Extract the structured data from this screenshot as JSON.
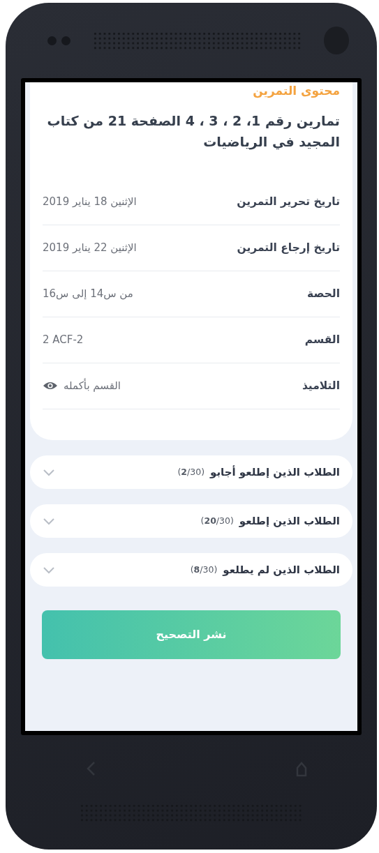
{
  "exercise": {
    "section_title": "محتوى التمرين",
    "title": "تمارين رقم 1، 2 ، 3 ، 4 الصفحة 21 من كتاب المجيد في الرياضيات"
  },
  "details": [
    {
      "label": "تاريخ تحرير التمرين",
      "value": "الإثنين 18 يناير 2019",
      "kind": "text"
    },
    {
      "label": "تاريخ إرجاع التمرين",
      "value": "الإثنين 22 يناير 2019",
      "kind": "text"
    },
    {
      "label": "الحصة",
      "value": "من س14 إلى س16",
      "kind": "text"
    },
    {
      "label": "القسم",
      "value": "2 ACF-2",
      "kind": "text"
    },
    {
      "label": "التلاميذ",
      "value": "القسم بأكمله",
      "kind": "eye"
    }
  ],
  "groups": [
    {
      "label": "الطلاب الذين إطلعو أجابو",
      "count": "(**2**/30)",
      "expanded": false
    },
    {
      "label": "الطلاب الذين إطلعو",
      "count": "(**20**/30)",
      "expanded": false
    },
    {
      "label": "الطلاب الذين لم يطلعو",
      "count": "(**8**/30)",
      "expanded": false
    }
  ],
  "publish_button": "نشر التصحيح"
}
